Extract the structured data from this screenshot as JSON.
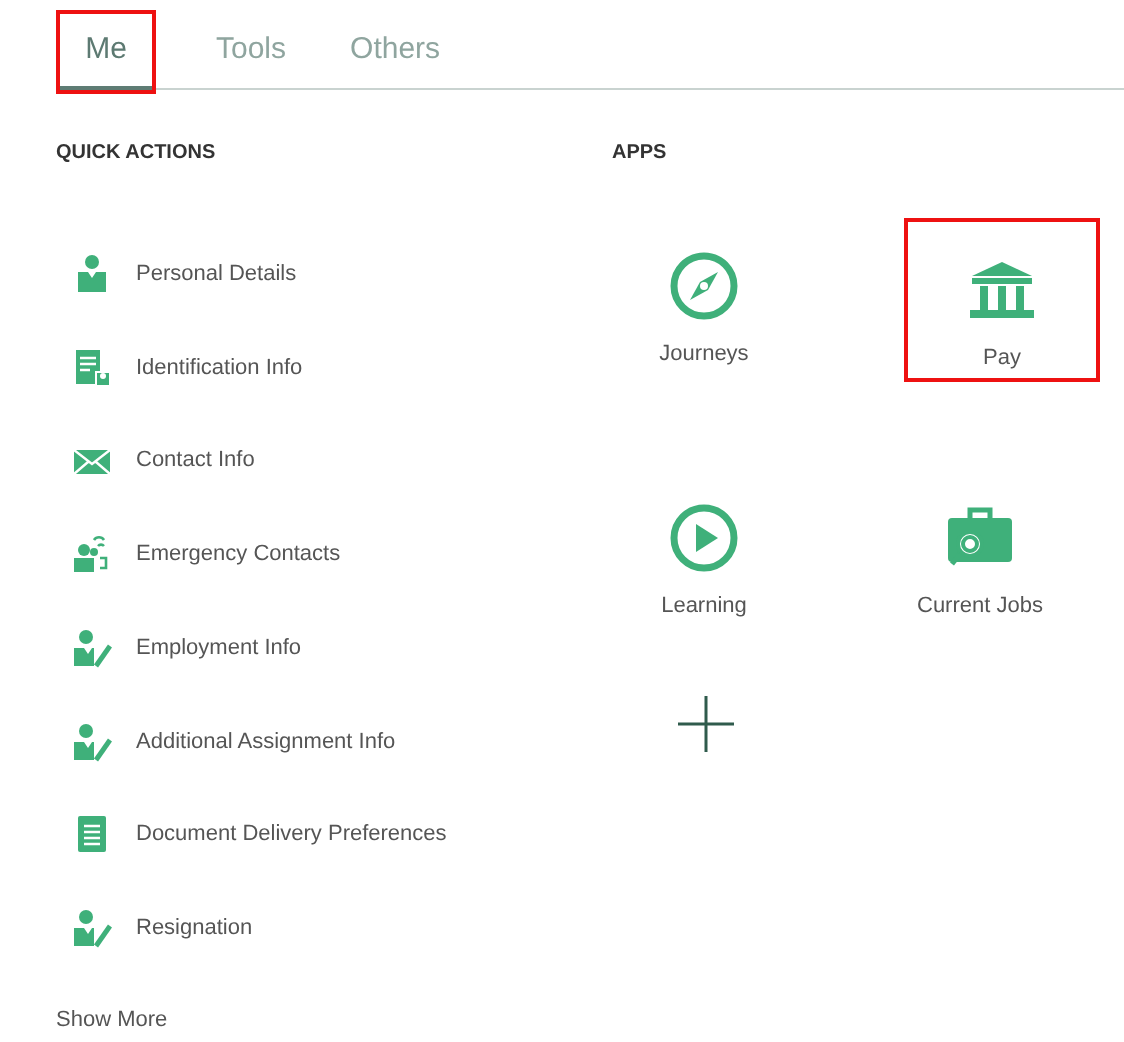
{
  "tabs": [
    {
      "label": "Me",
      "selected": true,
      "highlighted": true
    },
    {
      "label": "Tools",
      "selected": false,
      "highlighted": false
    },
    {
      "label": "Others",
      "selected": false,
      "highlighted": false
    }
  ],
  "quick_actions": {
    "heading": "QUICK ACTIONS",
    "items": [
      {
        "label": "Personal Details",
        "kind": "person"
      },
      {
        "label": "Identification Info",
        "kind": "id"
      },
      {
        "label": "Contact Info",
        "kind": "mail"
      },
      {
        "label": "Emergency Contacts",
        "kind": "group"
      },
      {
        "label": "Employment Info",
        "kind": "person-edit"
      },
      {
        "label": "Additional Assignment Info",
        "kind": "person-edit"
      },
      {
        "label": "Document Delivery Preferences",
        "kind": "document"
      },
      {
        "label": "Resignation",
        "kind": "person-edit"
      }
    ],
    "show_more": "Show More"
  },
  "apps": {
    "heading": "APPS",
    "items": [
      {
        "label": "Journeys",
        "kind": "compass",
        "highlighted": false
      },
      {
        "label": "Pay",
        "kind": "bank",
        "highlighted": true
      },
      {
        "label": "Learning",
        "kind": "play",
        "highlighted": false
      },
      {
        "label": "Current Jobs",
        "kind": "briefcase",
        "highlighted": false
      }
    ]
  }
}
